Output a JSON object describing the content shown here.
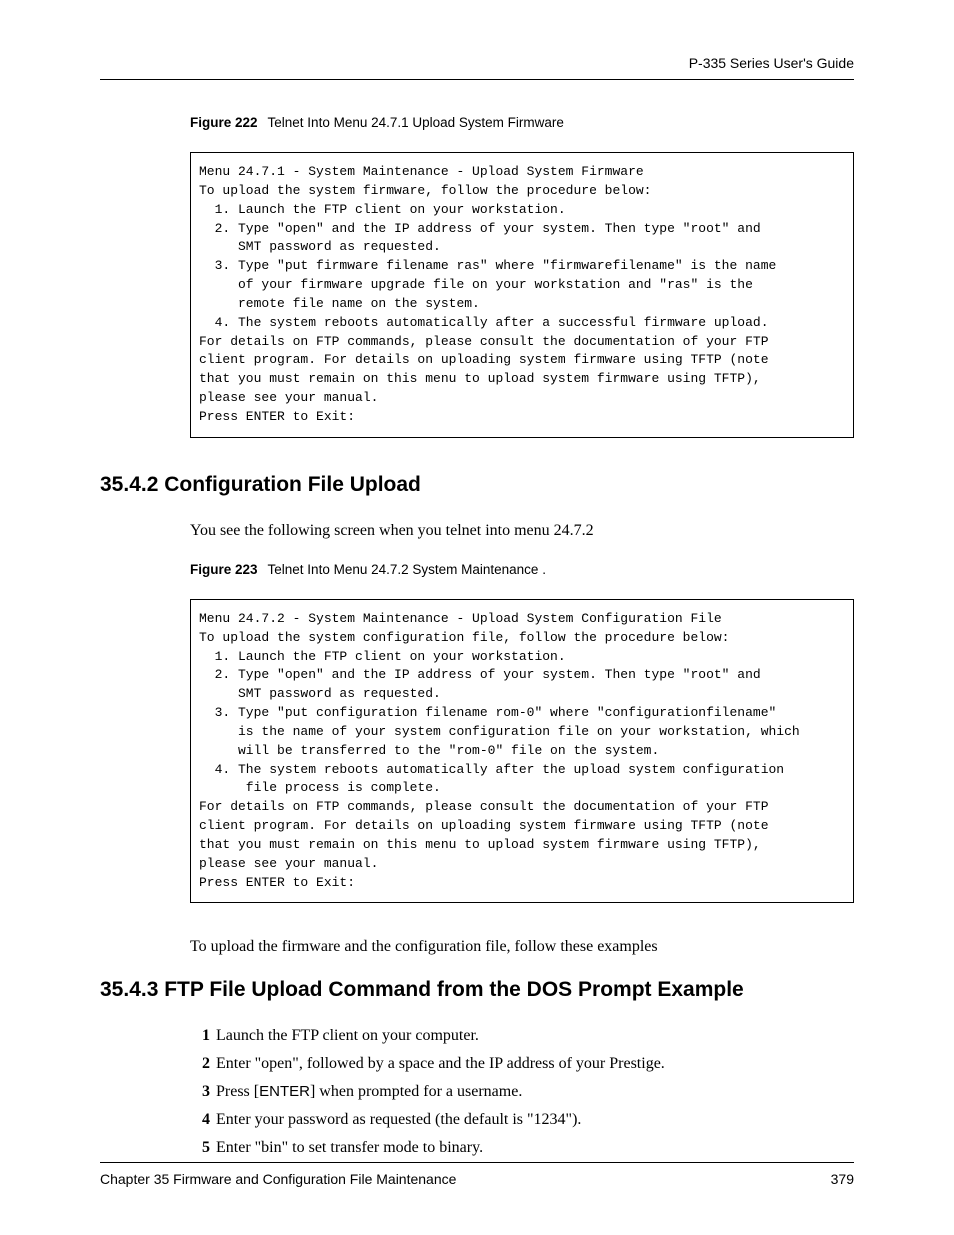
{
  "header": {
    "guide_title": "P-335 Series User's Guide"
  },
  "figure222": {
    "label": "Figure 222",
    "caption": "Telnet Into Menu 24.7.1 Upload System Firmware",
    "code": "Menu 24.7.1 - System Maintenance - Upload System Firmware\nTo upload the system firmware, follow the procedure below:\n  1. Launch the FTP client on your workstation.\n  2. Type \"open\" and the IP address of your system. Then type \"root\" and\n     SMT password as requested.\n  3. Type \"put firmware filename ras\" where \"firmwarefilename\" is the name\n     of your firmware upgrade file on your workstation and \"ras\" is the\n     remote file name on the system.\n  4. The system reboots automatically after a successful firmware upload.\nFor details on FTP commands, please consult the documentation of your FTP\nclient program. For details on uploading system firmware using TFTP (note\nthat you must remain on this menu to upload system firmware using TFTP),\nplease see your manual.\nPress ENTER to Exit:"
  },
  "section_3542": {
    "heading": "35.4.2  Configuration File Upload",
    "intro": "You see the following screen when you telnet into menu 24.7.2"
  },
  "figure223": {
    "label": "Figure 223",
    "caption": "Telnet Into Menu 24.7.2 System Maintenance .",
    "code": "Menu 24.7.2 - System Maintenance - Upload System Configuration File\nTo upload the system configuration file, follow the procedure below:\n  1. Launch the FTP client on your workstation.\n  2. Type \"open\" and the IP address of your system. Then type \"root\" and\n     SMT password as requested.\n  3. Type \"put configuration filename rom-0\" where \"configurationfilename\"\n     is the name of your system configuration file on your workstation, which\n     will be transferred to the \"rom-0\" file on the system.\n  4. The system reboots automatically after the upload system configuration\n      file process is complete.\nFor details on FTP commands, please consult the documentation of your FTP\nclient program. For details on uploading system firmware using TFTP (note\nthat you must remain on this menu to upload system firmware using TFTP),\nplease see your manual.\nPress ENTER to Exit:"
  },
  "post_figure_text": "To upload the firmware and the configuration file, follow these examples",
  "section_3543": {
    "heading": "35.4.3  FTP File Upload Command from the DOS Prompt Example",
    "steps": {
      "s1": "Launch the FTP client on your computer.",
      "s2": "Enter \"open\", followed by a space and the IP address of your Prestige.",
      "s3a": "Press [",
      "s3key": "ENTER",
      "s3b": "] when prompted for a username.",
      "s4": "Enter your password as requested (the default is \"1234\").",
      "s5": "Enter \"bin\" to set transfer mode to binary."
    }
  },
  "footer": {
    "chapter": "Chapter 35 Firmware and Configuration File Maintenance",
    "page": "379"
  }
}
